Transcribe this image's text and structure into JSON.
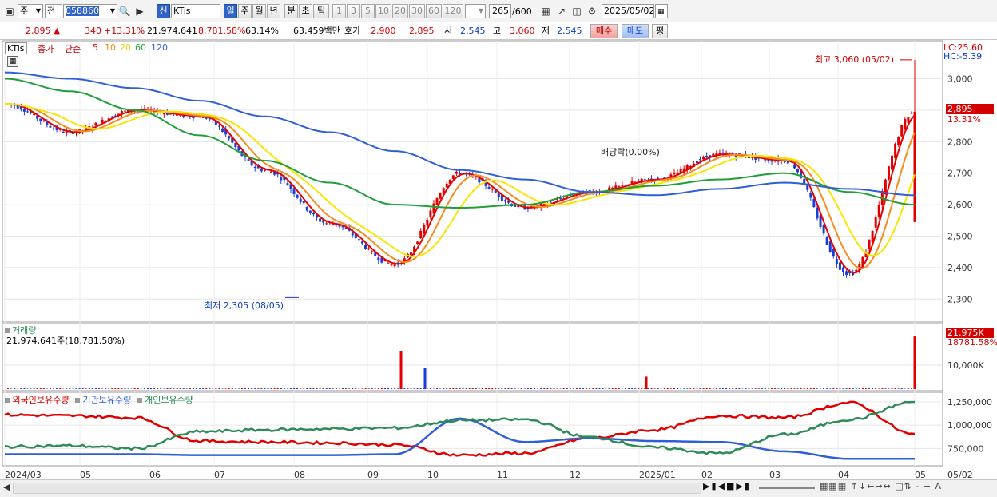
{
  "toolbar": {
    "market": "주",
    "view": "전",
    "code": "058860",
    "badge": "신",
    "name": "KTis",
    "periods": [
      "일",
      "주",
      "월",
      "년",
      "분",
      "초",
      "틱"
    ],
    "periods_active": "일",
    "minutes": [
      "1",
      "3",
      "5",
      "10",
      "20",
      "30",
      "60",
      "120"
    ],
    "count_value": "265",
    "count_total": "/600",
    "date": "2025/05/02"
  },
  "quote": {
    "price": "2,895",
    "change": "340",
    "change_pct": "+13.31%",
    "volume": "21,974,641",
    "vol_ratio": "8,781.58%",
    "turnover": "63.14%",
    "amount": "63,459백만",
    "bid_label": "호가",
    "ask": "2,900",
    "bid": "2,895",
    "open_label": "시",
    "open": "2,545",
    "high_label": "고",
    "high": "3,060",
    "low_label": "저",
    "low": "2,545",
    "buy_label": "매수",
    "sell_label": "매도",
    "avg_label": "평"
  },
  "colors": {
    "up": "#e00000",
    "down": "#1a3ed6",
    "ma5": "#e60000",
    "ma10": "#f58c1e",
    "ma20": "#f7e600",
    "ma60": "#1f9e3a",
    "ma120": "#2f5fd8",
    "foreign": "#e00000",
    "inst": "#2f5fd8",
    "indiv": "#2e8b57"
  },
  "chart_data": [
    {
      "type": "line",
      "title": "KTis",
      "legend": [
        "종가",
        "단순",
        "5",
        "10",
        "20",
        "60",
        "120"
      ],
      "ylim": [
        2250,
        3080
      ],
      "y_ticks": [
        "3,000",
        "2,900",
        "2,800",
        "2,700",
        "2,600",
        "2,500",
        "2,400",
        "2,300"
      ],
      "x_ticks": [
        "2024/03",
        "05",
        "06",
        "07",
        "08",
        "09",
        "10",
        "11",
        "12",
        "2025/01",
        "02",
        "03",
        "04",
        "05"
      ],
      "x": [
        "2024/03",
        "2024/04",
        "2024/05",
        "2024/06",
        "2024/07",
        "2024/08",
        "2024/09",
        "2024/10",
        "2024/11",
        "2024/12",
        "2025/01",
        "2025/02",
        "2025/03",
        "2025/04",
        "2025/05/02"
      ],
      "series": [
        {
          "name": "종가",
          "values": [
            2920,
            2830,
            2900,
            2880,
            2710,
            2540,
            2410,
            2700,
            2590,
            2640,
            2680,
            2760,
            2740,
            2380,
            2895
          ]
        },
        {
          "name": "60",
          "values": [
            3000,
            2960,
            2900,
            2820,
            2740,
            2670,
            2600,
            2590,
            2600,
            2640,
            2660,
            2680,
            2700,
            2640,
            2600
          ]
        },
        {
          "name": "120",
          "values": [
            3020,
            3000,
            2970,
            2930,
            2880,
            2830,
            2770,
            2710,
            2680,
            2640,
            2630,
            2650,
            2670,
            2650,
            2630
          ]
        }
      ],
      "annotations": [
        {
          "text": "최고 3,060 (05/02)",
          "value": 3060
        },
        {
          "text": "최저 2,305 (08/05)",
          "value": 2305
        },
        {
          "text": "배당락(0.00%)"
        }
      ],
      "right_labels": {
        "lc": "LC:25.60",
        "hc": "HC:-5.39",
        "last": "2,895",
        "last_pct": "13.31%"
      }
    },
    {
      "type": "bar",
      "title": "거래량",
      "subtitle": "21,974,641주(18,781.58%)",
      "y_ticks": [
        "10,000K"
      ],
      "ylim": [
        0,
        22000
      ],
      "x": [
        "2024/09/10",
        "2024/09/27",
        "2024/12/20",
        "2025/05/02"
      ],
      "values": [
        16000,
        9000,
        5200,
        21975
      ],
      "right_labels": {
        "last": "21,975K",
        "last_pct": "18781.58%"
      }
    },
    {
      "type": "line",
      "legend": [
        "외국인보유수량",
        "기관보유수량",
        "개인보유수량"
      ],
      "y_ticks": [
        "1,250,000",
        "1,000,000",
        "750,000"
      ],
      "ylim": [
        600000,
        1300000
      ],
      "x": [
        "2024/03",
        "2024/04",
        "2024/05",
        "2024/06",
        "2024/07",
        "2024/08",
        "2024/09",
        "2024/10",
        "2024/11",
        "2024/12",
        "2025/01",
        "2025/02",
        "2025/03",
        "2025/04",
        "2025/05/02"
      ],
      "series": [
        {
          "name": "외국인보유수량",
          "values": [
            1110,
            1100,
            1080,
            830,
            820,
            810,
            790,
            680,
            700,
            860,
            950,
            1100,
            1080,
            1240,
            900
          ]
        },
        {
          "name": "기관보유수량",
          "values": [
            690,
            690,
            690,
            680,
            680,
            680,
            690,
            1070,
            820,
            860,
            830,
            820,
            720,
            640,
            640
          ]
        },
        {
          "name": "개인보유수량",
          "values": [
            770,
            780,
            750,
            930,
            950,
            960,
            970,
            1050,
            1060,
            870,
            760,
            700,
            900,
            1060,
            1250
          ]
        }
      ]
    }
  ]
}
